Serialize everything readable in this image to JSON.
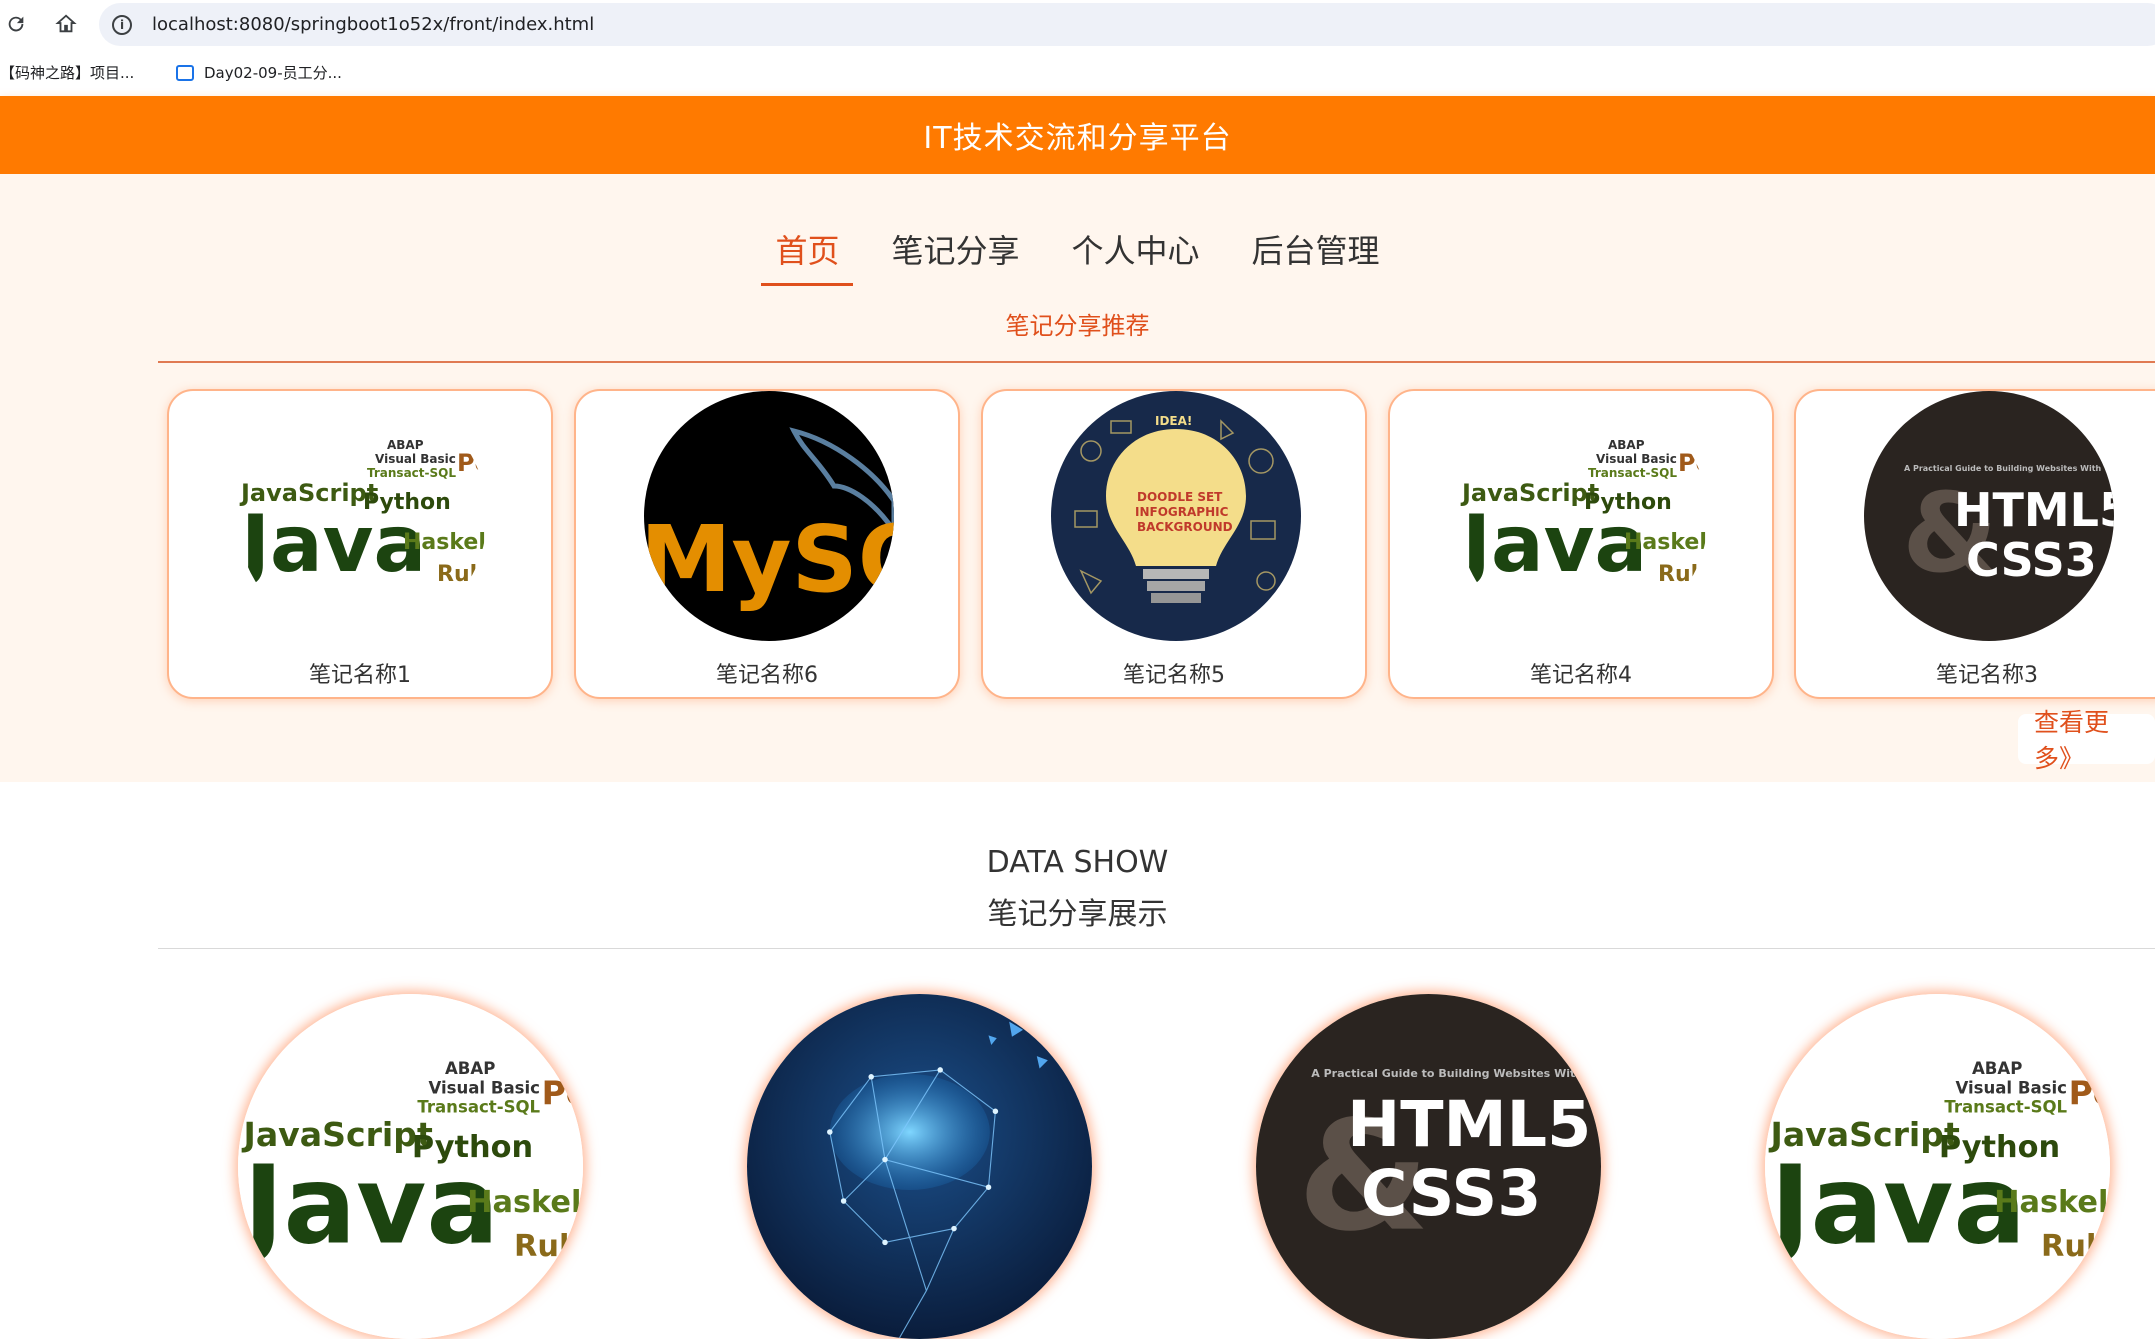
{
  "browser": {
    "url": "localhost:8080/springboot1o52x/front/index.html",
    "bookmarks": [
      {
        "label": "【码神之路】项目..."
      },
      {
        "label": "Day02-09-员工分..."
      }
    ]
  },
  "header": {
    "title": "IT技术交流和分享平台"
  },
  "nav": {
    "tabs": [
      {
        "label": "首页",
        "active": true
      },
      {
        "label": "笔记分享",
        "active": false
      },
      {
        "label": "个人中心",
        "active": false
      },
      {
        "label": "后台管理",
        "active": false
      }
    ]
  },
  "recommend": {
    "title": "笔记分享推荐",
    "items": [
      {
        "name": "笔记名称1",
        "image": "java-word-cloud"
      },
      {
        "name": "笔记名称6",
        "image": "mysql-logo"
      },
      {
        "name": "笔记名称5",
        "image": "doodle-lightbulb"
      },
      {
        "name": "笔记名称4",
        "image": "java-word-cloud"
      },
      {
        "name": "笔记名称3",
        "image": "html5-css3-cover"
      }
    ],
    "more_label": "查看更多》"
  },
  "data_show": {
    "title_en": "DATA SHOW",
    "title_cn": "笔记分享展示",
    "items": [
      {
        "image": "java-word-cloud"
      },
      {
        "image": "ai-brain"
      },
      {
        "image": "html5-css3-cover"
      },
      {
        "image": "java-word-cloud"
      }
    ]
  },
  "art": {
    "java": {
      "line1": "ABAP",
      "line2": "Visual Basic",
      "line3": "Transact-SQL",
      "line4": "JavaScript",
      "line5": "Python",
      "line6": "Java",
      "line7": "Haskell",
      "line8": "Ruby",
      "line9": "Perl"
    },
    "mysql": {
      "word": "MySQL"
    },
    "bulb": {
      "top": "IDEA!",
      "l1": "DOODLE SET",
      "l2": "INFOGRAPHIC",
      "l3": "BACKGROUND"
    },
    "html5": {
      "caption": "A Practical Guide to Building Websites With",
      "l1": "HTML5",
      "l2": "CSS3",
      "amp": "&"
    }
  },
  "colors": {
    "orange": "#ff7a00",
    "accent": "#e0501c",
    "peach": "#fff6ee",
    "card_border": "#ffb48a"
  }
}
